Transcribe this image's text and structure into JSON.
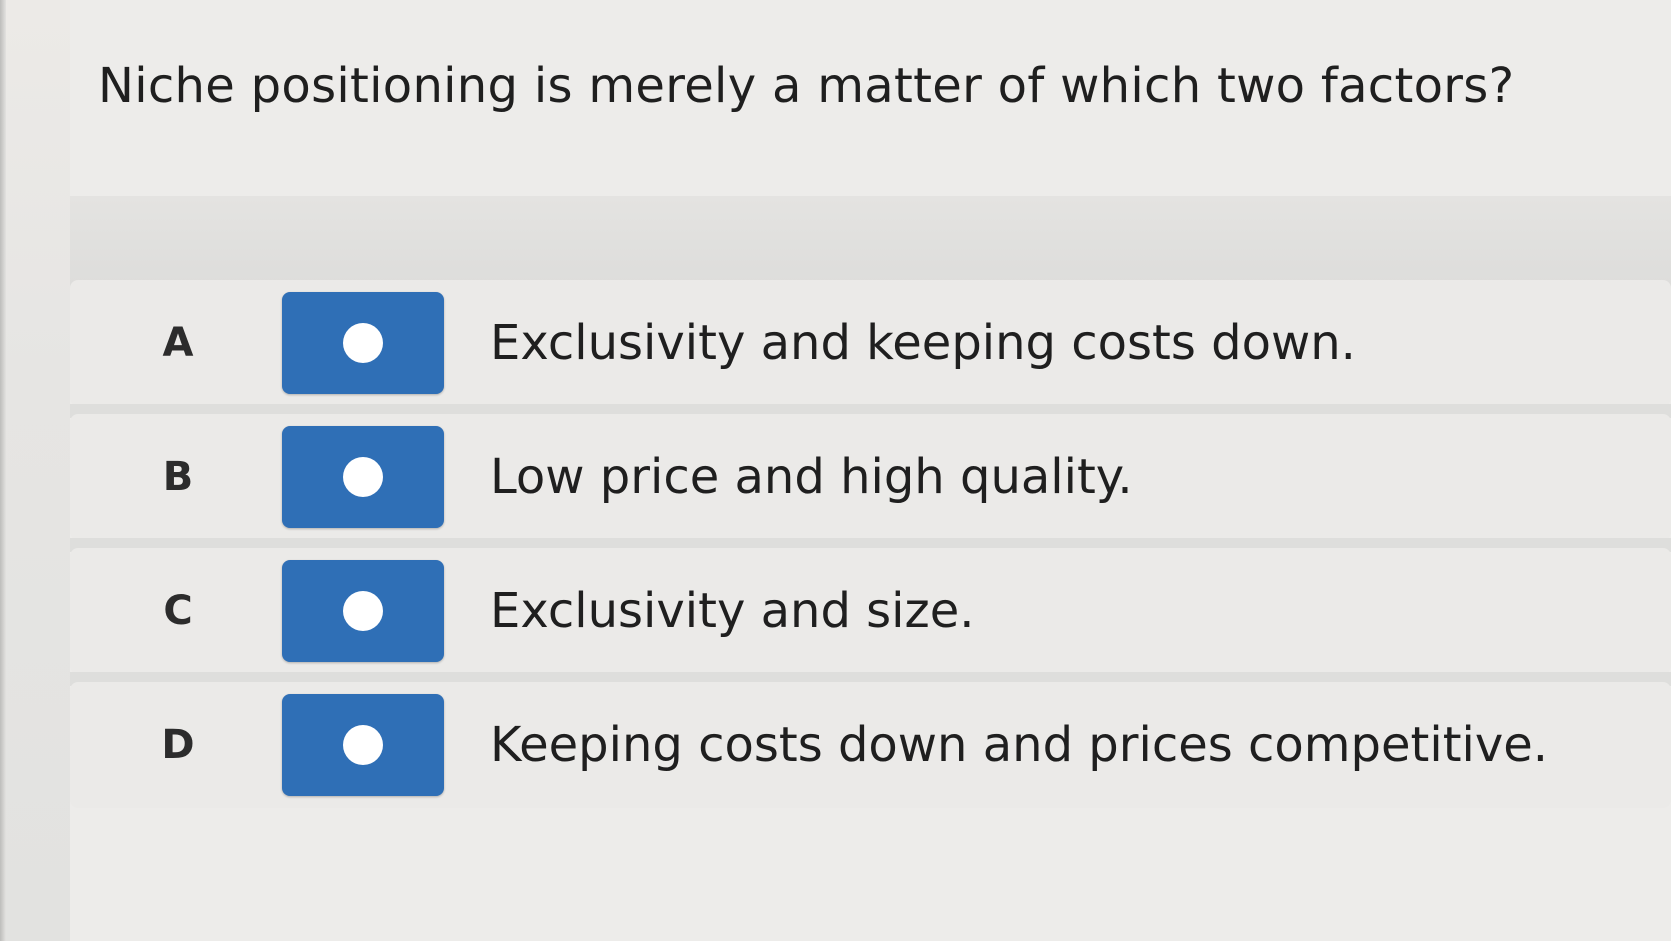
{
  "question": {
    "text": "Niche positioning is merely a matter of which two factors?"
  },
  "options": [
    {
      "letter": "A",
      "text": "Exclusivity and keeping costs down."
    },
    {
      "letter": "B",
      "text": "Low price and high quality."
    },
    {
      "letter": "C",
      "text": "Exclusivity and size."
    },
    {
      "letter": "D",
      "text": "Keeping costs down and prices competitive."
    }
  ],
  "colors": {
    "radio_button": "#2f6fb6",
    "radio_dot": "#ffffff",
    "background": "#edecea"
  },
  "icons": {
    "radio": "radio-unselected-icon"
  }
}
